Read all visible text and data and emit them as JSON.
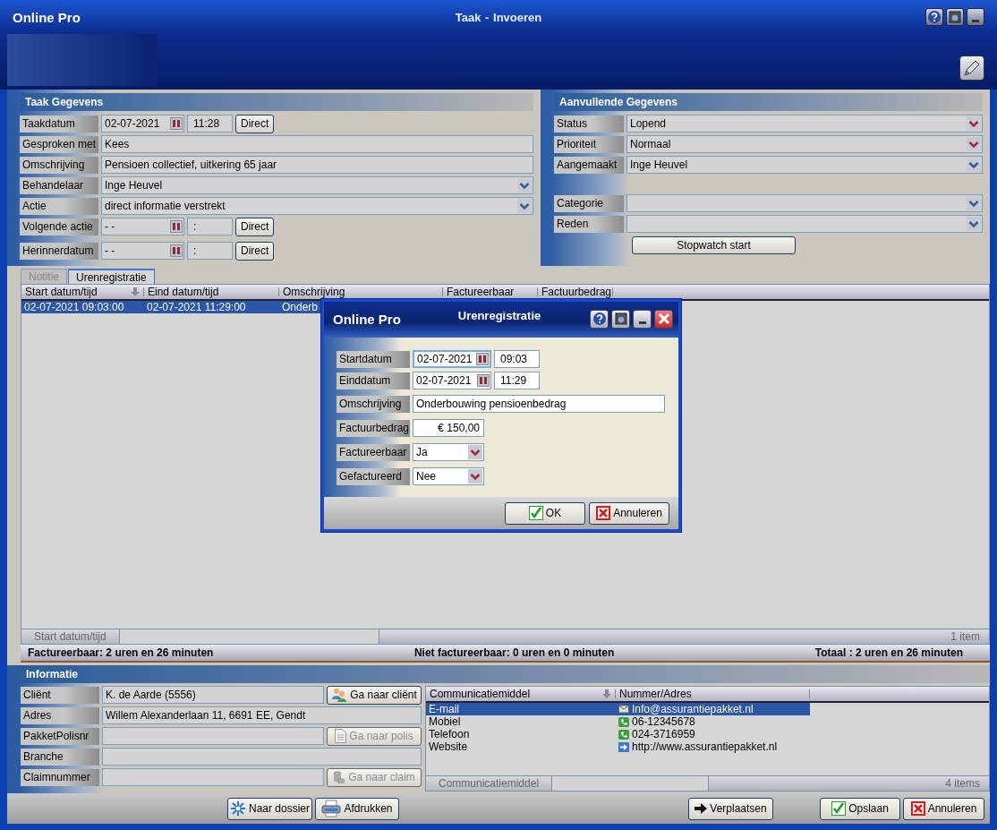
{
  "window": {
    "app_name": "Online Pro",
    "title": "Taak  -  Invoeren"
  },
  "taak_gegevens": {
    "title": "Taak Gegevens",
    "groups": [
      [
        {
          "kind": "date",
          "label": "Taakdatum",
          "date": "02-07-2021",
          "time": "11:28",
          "button": "Direct"
        },
        {
          "kind": "text",
          "label": "Gesproken met",
          "value": "Kees"
        },
        {
          "kind": "text",
          "label": "Omschrijving",
          "value": "Pensioen collectief, uitkering 65 jaar"
        },
        {
          "kind": "select",
          "label": "Behandelaar",
          "value": "Inge Heuvel",
          "required": false
        },
        {
          "kind": "select",
          "label": "Actie",
          "value": "direct informatie verstrekt",
          "required": false
        },
        {
          "kind": "date",
          "label": "Volgende actie",
          "date": "- -",
          "time": ":",
          "button": "Direct"
        }
      ],
      [
        {
          "kind": "date",
          "label": "Herinnerdatum",
          "date": "- -",
          "time": ":",
          "button": "Direct"
        }
      ]
    ]
  },
  "aanvullende_gegevens": {
    "title": "Aanvullende Gegevens",
    "groups": [
      [
        {
          "kind": "select",
          "label": "Status",
          "value": "Lopend",
          "required": true
        },
        {
          "kind": "select",
          "label": "Prioriteit",
          "value": "Normaal",
          "required": true
        },
        {
          "kind": "select",
          "label": "Aangemaakt",
          "value": "Inge Heuvel",
          "required": false
        }
      ],
      [
        {
          "kind": "select",
          "label": "Categorie",
          "required": false
        },
        {
          "kind": "select",
          "label": "Reden",
          "required": false
        }
      ]
    ],
    "button": "Stopwatch start"
  },
  "tabs": [
    {
      "label": "Notitie",
      "selected": false
    },
    {
      "label": "Urenregistratie",
      "selected": true
    }
  ],
  "hours_table": {
    "columns": [
      {
        "label": "Start datum/tijd",
        "sorted": true
      },
      {
        "label": "Eind datum/tijd",
        "sorted": false
      },
      {
        "label": "Omschrijving",
        "sorted": false
      },
      {
        "label": "Factureerbaar",
        "sorted": false
      },
      {
        "label": "Factuurbedrag",
        "sorted": false
      }
    ],
    "rows": [
      {
        "selected": true,
        "cells": [
          "02-07-2021 09:03:00",
          "02-07-2021 11:29:00",
          "Onderb"
        ]
      }
    ],
    "group_by": "Start datum/tijd",
    "count": "1 item"
  },
  "summary": [
    "Factureerbaar: 2 uren en 26 minuten",
    "Niet factureerbaar: 0 uren en 0 minuten",
    "Totaal : 2 uren en 26 minuten"
  ],
  "informatie": {
    "title": "Informatie",
    "rows": [
      {
        "kind": "text",
        "label": "Cliënt",
        "value": "K. de Aarde (5556)",
        "button": {
          "label": "Ga naar cliënt",
          "disabled": false
        }
      },
      {
        "kind": "text",
        "label": "Adres",
        "value": "Willem Alexanderlaan 11,  6691 EE, Gendt"
      },
      {
        "kind": "text",
        "label": "PakketPolisnr",
        "button": {
          "label": "Ga naar polis",
          "disabled": true
        }
      },
      {
        "kind": "text",
        "label": "Branche"
      },
      {
        "kind": "text",
        "label": "Claimnummer",
        "button": {
          "label": "Ga naar claim",
          "disabled": true
        }
      }
    ]
  },
  "communication": {
    "columns": [
      {
        "label": "Communicatiemiddel",
        "sorted": true
      },
      {
        "label": "Nummer/Adres",
        "sorted": false
      }
    ],
    "rows": [
      {
        "kind": "email",
        "selected": true,
        "cells": [
          "E-mail",
          "Info@assurantiepakket.nl"
        ]
      },
      {
        "kind": "phone",
        "selected": false,
        "cells": [
          "Mobiel",
          "06-12345678"
        ]
      },
      {
        "kind": "phone",
        "selected": false,
        "cells": [
          "Telefoon",
          "024-3716959"
        ]
      },
      {
        "kind": "web",
        "selected": false,
        "cells": [
          "Website",
          "http://www.assurantiepakket.nl"
        ]
      }
    ],
    "group_by": "Communicatiemiddel",
    "count": "4 items"
  },
  "bottom_buttons": [
    "Naar dossier",
    "Afdrukken",
    "Verplaatsen",
    "Opslaan",
    "Annuleren"
  ],
  "dialog": {
    "app_name": "Online Pro",
    "title": "Urenregistratie",
    "rows": [
      {
        "kind": "date",
        "label": "Startdatum",
        "date": "02-07-2021",
        "time": "09:03",
        "focused": true
      },
      {
        "kind": "date",
        "label": "Einddatum",
        "date": "02-07-2021",
        "time": "11:29",
        "focused": false
      },
      {
        "kind": "text",
        "label": "Omschrijving",
        "value": "Onderbouwing pensioenbedrag",
        "focused": false
      },
      {
        "kind": "amount",
        "label": "Factuurbedrag",
        "value": "€ 150,00",
        "focused": false
      },
      {
        "kind": "select",
        "label": "Factureerbaar",
        "value": "Ja",
        "required": true,
        "focused": false
      },
      {
        "kind": "select",
        "label": "Gefactureerd",
        "value": "Nee",
        "required": true,
        "focused": false
      }
    ],
    "buttons": [
      "OK",
      "Annuleren"
    ]
  }
}
